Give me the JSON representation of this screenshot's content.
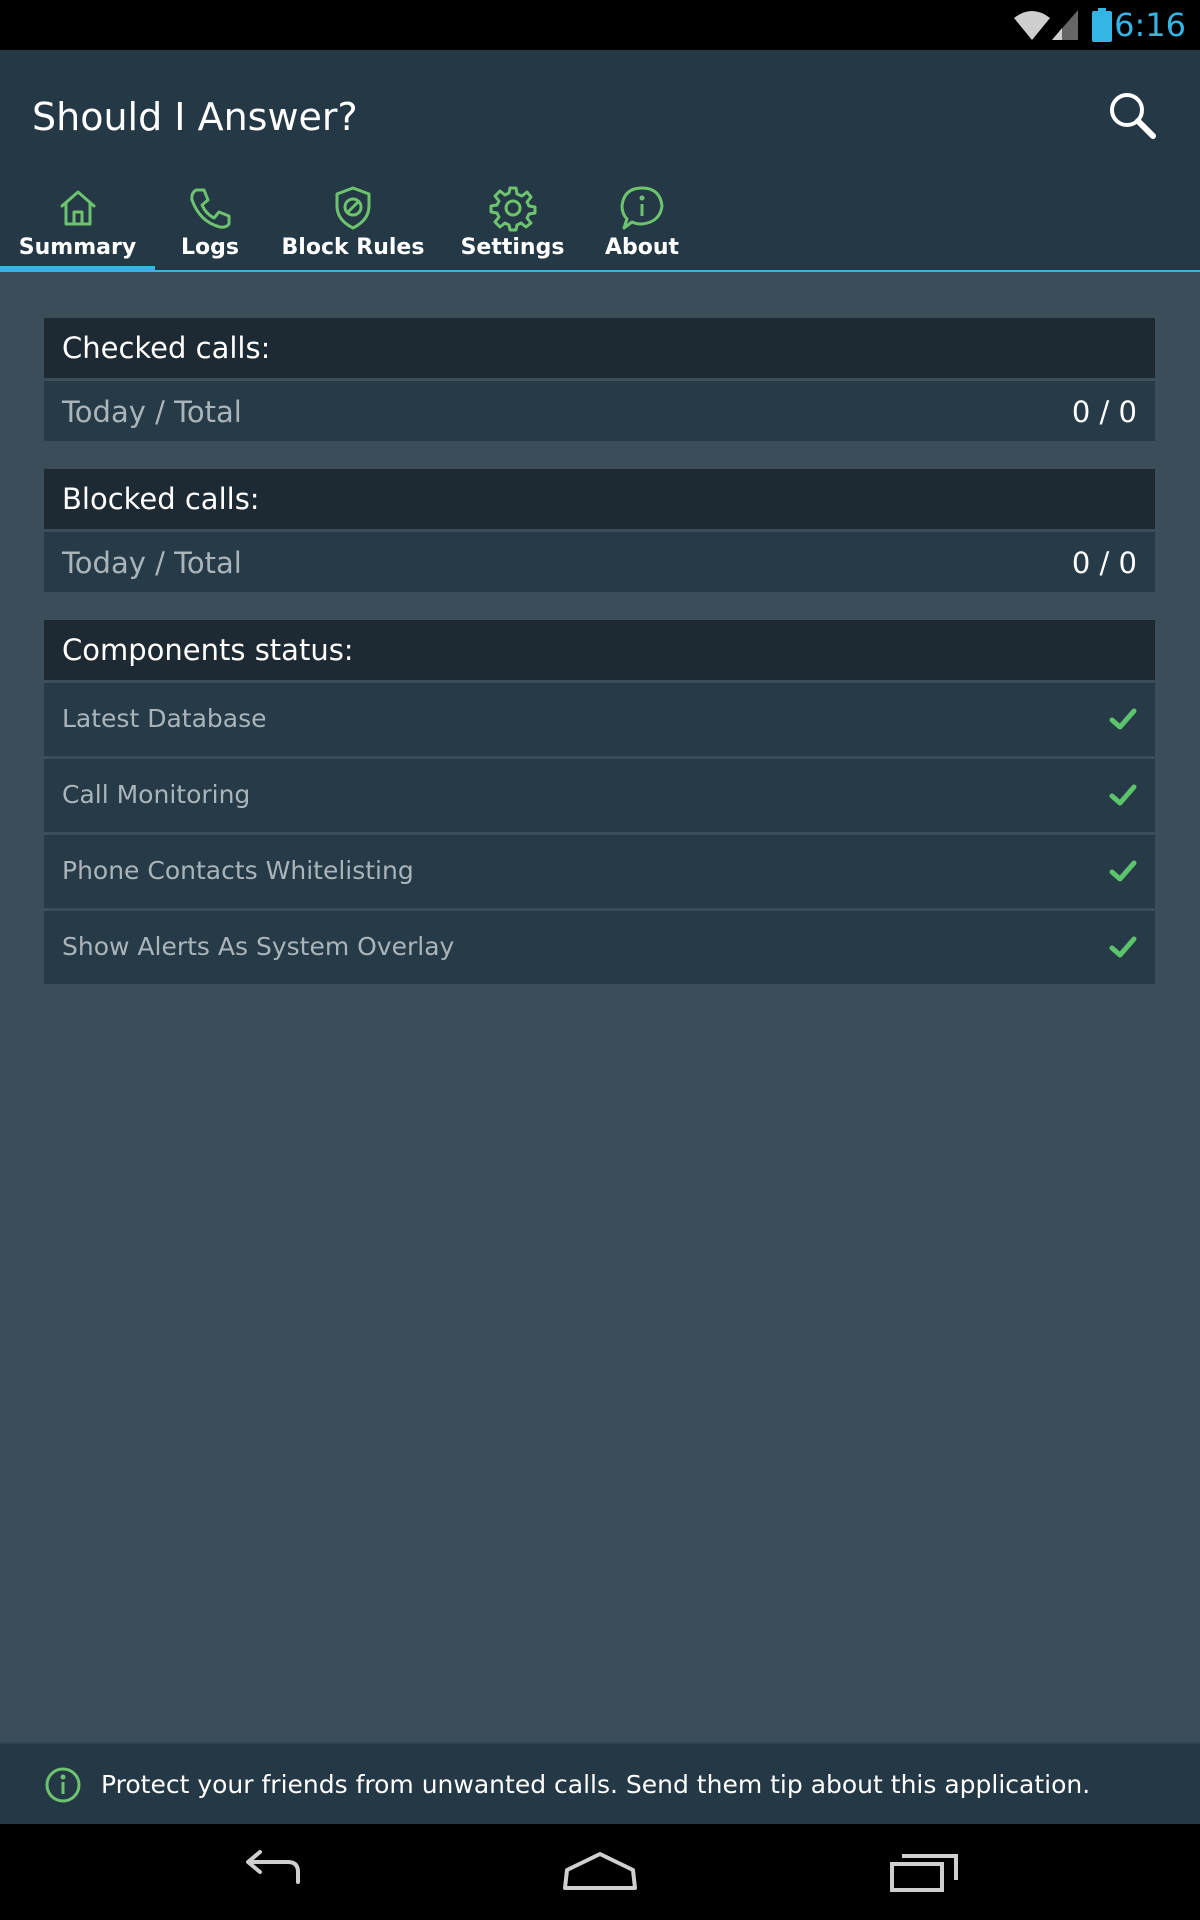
{
  "status_bar": {
    "time": "6:16",
    "icons": [
      "wifi-icon",
      "signal-icon",
      "battery-icon"
    ]
  },
  "app_bar": {
    "title": "Should I Answer?",
    "search_icon": "search-icon"
  },
  "tabs": [
    {
      "label": "Summary",
      "icon": "home-icon",
      "selected": true
    },
    {
      "label": "Logs",
      "icon": "phone-icon",
      "selected": false
    },
    {
      "label": "Block Rules",
      "icon": "shield-icon",
      "selected": false
    },
    {
      "label": "Settings",
      "icon": "gear-icon",
      "selected": false
    },
    {
      "label": "About",
      "icon": "info-icon",
      "selected": false
    }
  ],
  "checked_calls": {
    "header": "Checked calls:",
    "label": "Today / Total",
    "value": "0 / 0"
  },
  "blocked_calls": {
    "header": "Blocked calls:",
    "label": "Today / Total",
    "value": "0 / 0"
  },
  "components": {
    "header": "Components status:",
    "items": [
      {
        "label": "Latest Database",
        "status_icon": "check-icon"
      },
      {
        "label": "Call Monitoring",
        "status_icon": "check-icon"
      },
      {
        "label": "Phone Contacts Whitelisting",
        "status_icon": "check-icon"
      },
      {
        "label": "Show Alerts As System Overlay",
        "status_icon": "check-icon"
      }
    ]
  },
  "footer": {
    "icon": "info-icon",
    "text": "Protect your friends from unwanted calls. Send them tip about this application."
  },
  "nav_bar": {
    "buttons": [
      "back-icon",
      "home-icon",
      "recent-apps-icon"
    ]
  },
  "colors": {
    "accent": "#33b5e5",
    "icon_green": "#6ec46e",
    "app_bar": "#243845",
    "background": "#3c4d5a",
    "card_header": "#1d2a33",
    "card_row": "#263a47"
  }
}
